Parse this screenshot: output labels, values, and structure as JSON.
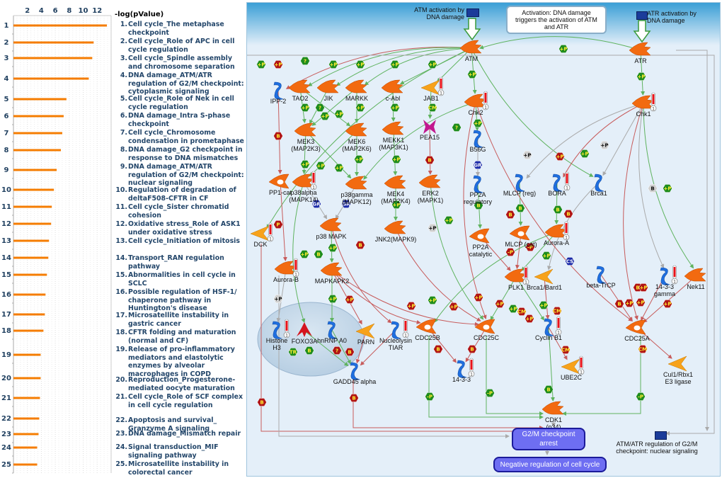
{
  "chart_data": {
    "type": "bar",
    "orientation": "horizontal",
    "title": "",
    "xlabel": "-log(pValue)",
    "ylabel": "",
    "xlim": [
      0,
      14
    ],
    "x_ticks": [
      2,
      4,
      6,
      8,
      10,
      12
    ],
    "grid": true,
    "bar_color": "#f57c00",
    "categories": [
      "1",
      "2",
      "3",
      "4",
      "5",
      "6",
      "7",
      "8",
      "9",
      "10",
      "11",
      "12",
      "13",
      "14",
      "15",
      "16",
      "17",
      "18",
      "19",
      "20",
      "21",
      "22",
      "23",
      "24",
      "25"
    ],
    "values": [
      13.4,
      11.5,
      11.3,
      10.8,
      7.6,
      7.2,
      7.0,
      6.8,
      6.2,
      5.8,
      5.5,
      5.4,
      5.1,
      5.0,
      4.8,
      4.6,
      4.5,
      4.3,
      3.9,
      3.9,
      3.8,
      3.7,
      3.6,
      3.4,
      3.4
    ]
  },
  "pathways": [
    {
      "num": "1.",
      "label": "Cell cycle_The metaphase checkpoint"
    },
    {
      "num": "2.",
      "label": "Cell cycle_Role of APC in cell cycle regulation"
    },
    {
      "num": "3.",
      "label": "Cell cycle_Spindle assembly and chromosome separation"
    },
    {
      "num": "4.",
      "label": "DNA damage_ATM/ATR regulation of G2/M checkpoint: cytoplasmic signaling"
    },
    {
      "num": "5.",
      "label": "Cell cycle_Role of Nek in cell cycle regulation"
    },
    {
      "num": "6.",
      "label": "DNA damage_Intra S-phase checkpoint"
    },
    {
      "num": "7.",
      "label": "Cell cycle_Chromosome condensation in prometaphase"
    },
    {
      "num": "8.",
      "label": "DNA damage_G2 checkpoint in response to DNA mismatches"
    },
    {
      "num": "9.",
      "label": "DNA damage_ATM/ATR regulation of G2/M checkpoint: nuclear signaling"
    },
    {
      "num": "10.",
      "label": "Regulation of degradation of deltaF508-CFTR in CF"
    },
    {
      "num": "11.",
      "label": "Cell cycle_Sister chromatid cohesion"
    },
    {
      "num": "12.",
      "label": "Oxidative stress_Role of ASK1 under oxidative stress"
    },
    {
      "num": "13.",
      "label": "Cell cycle_Initiation of mitosis"
    },
    {
      "num": "14.",
      "label": "Transport_RAN regulation pathway"
    },
    {
      "num": "15.",
      "label": "Abnormalities in cell cycle in SCLC"
    },
    {
      "num": "16.",
      "label": "Possible regulation of HSF-1/ chaperone pathway in Huntington's disease"
    },
    {
      "num": "17.",
      "label": "Microsatellite instability in gastric cancer"
    },
    {
      "num": "18.",
      "label": "CFTR folding and maturation (normal and CF)"
    },
    {
      "num": "19.",
      "label": "Release of pro-inflammatory mediators and elastolytic enzymes by alveolar macrophages in COPD"
    },
    {
      "num": "20.",
      "label": "Reproduction_Progesterone-mediated oocyte maturation"
    },
    {
      "num": "21.",
      "label": "Cell cycle_Role of SCF complex in cell cycle regulation"
    },
    {
      "num": "22.",
      "label": "Apoptosis and survival_ Granzyme A signaling"
    },
    {
      "num": "23.",
      "label": "DNA damage_Mismatch repair"
    },
    {
      "num": "24.",
      "label": "Signal transduction_MIF signaling pathway"
    },
    {
      "num": "25.",
      "label": "Microsatellite instability in colorectal cancer"
    }
  ],
  "map": {
    "note": "Activation: DNA damage triggers the activation of ATM and ATR",
    "atm_activation": "ATM activation by DNA damage",
    "atr_activation": "ATR activation by DNA damage",
    "nuclear_signaling": "ATM/ATR regulation of G2/M checkpoint: nuclear signaling",
    "g2m_arrest": "G2/M checkpoint arrest",
    "neg_regulation": "Negative regulation of cell cycle",
    "colors": {
      "kinase": "#f26a10",
      "ligand": "#f7a21b",
      "protein": "#1f6fe0",
      "green_edge": "#5fb35f",
      "red_edge": "#c75b5b",
      "gray_edge": "#aaaaaa",
      "hex_green": "#1e8c1e",
      "hex_red": "#b01515",
      "hex_blue": "#1a2aa8",
      "process": "#6e6ef2"
    },
    "nodes": [
      {
        "id": "ATM",
        "label": "ATM",
        "type": "kinase"
      },
      {
        "id": "ATR",
        "label": "ATR",
        "type": "kinase"
      },
      {
        "id": "IPP2",
        "label": "IPP-2",
        "type": "protein"
      },
      {
        "id": "TAO2",
        "label": "TAO2",
        "type": "kinase"
      },
      {
        "id": "JIK",
        "label": "JIK",
        "type": "kinase"
      },
      {
        "id": "MARKK",
        "label": "MARKK",
        "type": "kinase"
      },
      {
        "id": "cAbl",
        "label": "c-Abl",
        "type": "kinase"
      },
      {
        "id": "JAB1",
        "label": "JAB1",
        "type": "ligand",
        "therm": "1"
      },
      {
        "id": "Chk2",
        "label": "Chk2",
        "type": "kinase",
        "therm": "1"
      },
      {
        "id": "Chk1",
        "label": "Chk1",
        "type": "kinase",
        "therm": "1"
      },
      {
        "id": "MEK3",
        "label": "MEK3|(MAP2K3)",
        "type": "kinase"
      },
      {
        "id": "MEK6",
        "label": "MEK6|(MAP2K6)",
        "type": "kinase"
      },
      {
        "id": "MEKK1",
        "label": "MEKK1|(MAP3K1)",
        "type": "kinase"
      },
      {
        "id": "PEA15",
        "label": "PEA15",
        "type": "receptor"
      },
      {
        "id": "B56G",
        "label": "B56G",
        "type": "protein"
      },
      {
        "id": "PP1cat",
        "label": "PP1-cat",
        "type": "phosphatase"
      },
      {
        "id": "p38alpha",
        "label": "p38alpha|(MAPK14)",
        "type": "kinase",
        "therm": "1"
      },
      {
        "id": "p38gamma",
        "label": "p38gamma|(MAPK12)",
        "type": "kinase"
      },
      {
        "id": "MEK4",
        "label": "MEK4|(MAP2K4)",
        "type": "kinase"
      },
      {
        "id": "ERK2",
        "label": "ERK2|(MAPK1)",
        "type": "kinase"
      },
      {
        "id": "PP2Areg",
        "label": "PP2A|regulatory",
        "type": "protein"
      },
      {
        "id": "MLCPreg",
        "label": "MLCP (reg)",
        "type": "protein"
      },
      {
        "id": "BORA",
        "label": "BORA",
        "type": "protein",
        "therm": "1"
      },
      {
        "id": "Brca1",
        "label": "Brca1",
        "type": "protein"
      },
      {
        "id": "DCK",
        "label": "DCK",
        "type": "ligand",
        "therm": "1"
      },
      {
        "id": "p38MAPK",
        "label": "p38 MAPK",
        "type": "kinase"
      },
      {
        "id": "JNK2",
        "label": "JNK2(MAPK9)",
        "type": "kinase"
      },
      {
        "id": "PP2Acat",
        "label": "PP2A|catalytic",
        "type": "phosphatase"
      },
      {
        "id": "MLCPcat",
        "label": "MLCP (cat)",
        "type": "phosphatase"
      },
      {
        "id": "AuroraA",
        "label": "Aurora-A",
        "type": "kinase",
        "therm": "1"
      },
      {
        "id": "AuroraB",
        "label": "Aurora-B",
        "type": "kinase",
        "therm": "1"
      },
      {
        "id": "MAPKAPK2",
        "label": "MAPKAPK2",
        "type": "kinase"
      },
      {
        "id": "PLK1",
        "label": "PLK1",
        "type": "kinase",
        "therm": "1"
      },
      {
        "id": "Brca1Bard1",
        "label": "Brca1/Bard1",
        "type": "ligand"
      },
      {
        "id": "betaTrCP",
        "label": "beta-TrCP",
        "type": "protein"
      },
      {
        "id": "1433g",
        "label": "14-3-3|gamma",
        "type": "protein",
        "therm": "1"
      },
      {
        "id": "Nek11",
        "label": "Nek11",
        "type": "kinase"
      },
      {
        "id": "HistoneH3",
        "label": "Histone|H3",
        "type": "protein",
        "therm": "1"
      },
      {
        "id": "FOXO3A",
        "label": "FOXO3A",
        "type": "tf"
      },
      {
        "id": "hnRNPA0",
        "label": "hnRNP A0",
        "type": "protein"
      },
      {
        "id": "PARN",
        "label": "PARN",
        "type": "ligand"
      },
      {
        "id": "TIAR",
        "label": "Nucleolysin|TIAR",
        "type": "protein",
        "therm": "1"
      },
      {
        "id": "CDC25B",
        "label": "CDC25B",
        "type": "phosphatase"
      },
      {
        "id": "CDC25C",
        "label": "CDC25C",
        "type": "phosphatase"
      },
      {
        "id": "CyclinB1",
        "label": "Cyclin B1",
        "type": "protein",
        "therm": "1"
      },
      {
        "id": "CDC25A",
        "label": "CDC25A",
        "type": "phosphatase"
      },
      {
        "id": "1433",
        "label": "14-3-3",
        "type": "protein",
        "therm": "1"
      },
      {
        "id": "UBE2C",
        "label": "UBE2C",
        "type": "ligand",
        "therm": "1"
      },
      {
        "id": "Cul1",
        "label": "Cul1/Rbx1|E3 ligase",
        "type": "ligand"
      },
      {
        "id": "GADD45",
        "label": "GADD45 alpha",
        "type": "protein"
      },
      {
        "id": "CDK1",
        "label": "CDK1|(p34)",
        "type": "kinase"
      }
    ]
  }
}
